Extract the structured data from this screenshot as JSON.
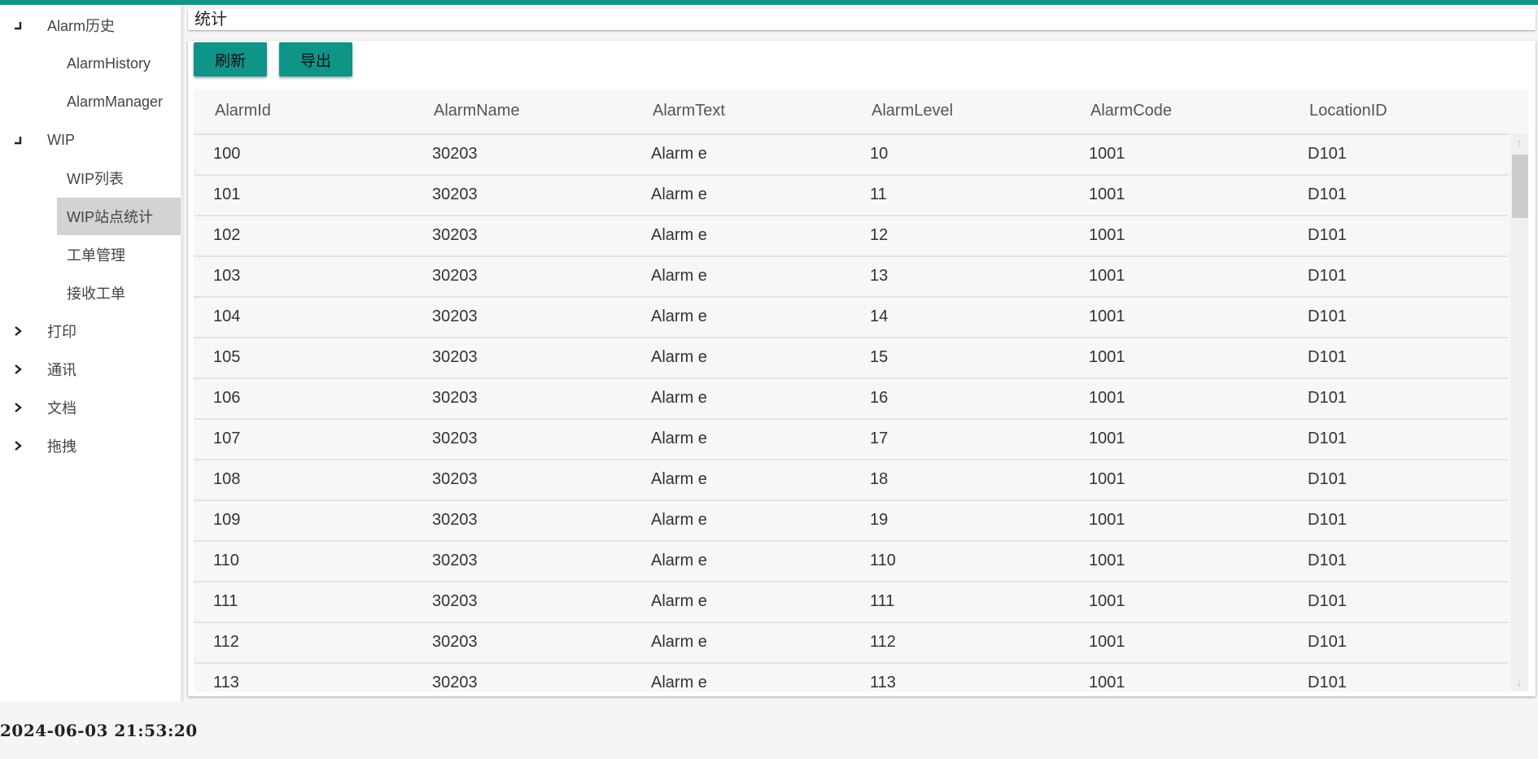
{
  "sidebar": {
    "groups": [
      {
        "label": "Alarm历史",
        "expanded": true,
        "children": [
          "AlarmHistory",
          "AlarmManager"
        ]
      },
      {
        "label": "WIP",
        "expanded": true,
        "children": [
          "WIP列表",
          "WIP站点统计",
          "工单管理",
          "接收工单"
        ],
        "selected_child": "WIP站点统计"
      },
      {
        "label": "打印",
        "expanded": false
      },
      {
        "label": "通讯",
        "expanded": false
      },
      {
        "label": "文档",
        "expanded": false
      },
      {
        "label": "拖拽",
        "expanded": false
      }
    ]
  },
  "header": {
    "title": "统计"
  },
  "toolbar": {
    "refresh_label": "刷新",
    "export_label": "导出"
  },
  "table": {
    "columns": [
      "AlarmId",
      "AlarmName",
      "AlarmText",
      "AlarmLevel",
      "AlarmCode",
      "LocationID"
    ],
    "rows": [
      [
        "100",
        "30203",
        "Alarm e",
        "10",
        "1001",
        "D101"
      ],
      [
        "101",
        "30203",
        "Alarm e",
        "11",
        "1001",
        "D101"
      ],
      [
        "102",
        "30203",
        "Alarm e",
        "12",
        "1001",
        "D101"
      ],
      [
        "103",
        "30203",
        "Alarm e",
        "13",
        "1001",
        "D101"
      ],
      [
        "104",
        "30203",
        "Alarm e",
        "14",
        "1001",
        "D101"
      ],
      [
        "105",
        "30203",
        "Alarm e",
        "15",
        "1001",
        "D101"
      ],
      [
        "106",
        "30203",
        "Alarm e",
        "16",
        "1001",
        "D101"
      ],
      [
        "107",
        "30203",
        "Alarm e",
        "17",
        "1001",
        "D101"
      ],
      [
        "108",
        "30203",
        "Alarm e",
        "18",
        "1001",
        "D101"
      ],
      [
        "109",
        "30203",
        "Alarm e",
        "19",
        "1001",
        "D101"
      ],
      [
        "110",
        "30203",
        "Alarm e",
        "110",
        "1001",
        "D101"
      ],
      [
        "111",
        "30203",
        "Alarm e",
        "111",
        "1001",
        "D101"
      ],
      [
        "112",
        "30203",
        "Alarm e",
        "112",
        "1001",
        "D101"
      ],
      [
        "113",
        "30203",
        "Alarm e",
        "113",
        "1001",
        "D101"
      ]
    ]
  },
  "status": {
    "datetime": "2024-06-03 21:53:20"
  },
  "colors": {
    "accent": "#0f9488",
    "selected_bg": "#d3d3d3"
  },
  "icons": {
    "expanded": "expanded-corner-icon",
    "collapsed": "chevron-right-icon"
  }
}
